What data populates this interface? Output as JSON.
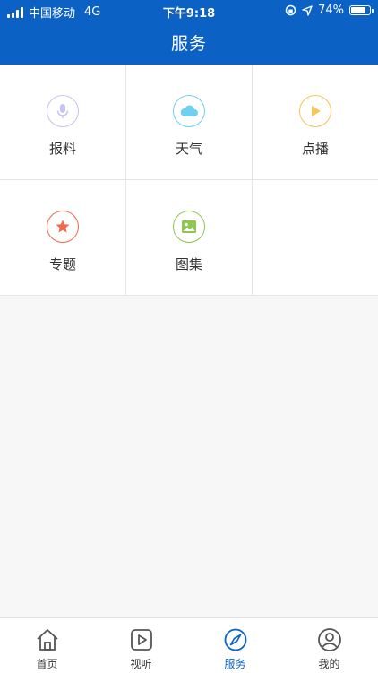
{
  "status_bar": {
    "carrier": "中国移动",
    "network": "4G",
    "time": "下午9:18",
    "battery_percent": "74%",
    "battery_level": 0.74
  },
  "header": {
    "title": "服务"
  },
  "services": [
    {
      "label": "报料",
      "icon": "microphone-icon",
      "color": "#c7c4ef"
    },
    {
      "label": "天气",
      "icon": "cloud-icon",
      "color": "#6fd1ee"
    },
    {
      "label": "点播",
      "icon": "play-icon",
      "color": "#f7c659"
    },
    {
      "label": "专题",
      "icon": "star-icon",
      "color": "#f06a4c"
    },
    {
      "label": "图集",
      "icon": "image-icon",
      "color": "#8ec74d"
    }
  ],
  "tabs": [
    {
      "label": "首页",
      "icon": "home-icon",
      "active": false
    },
    {
      "label": "视听",
      "icon": "video-play-icon",
      "active": false
    },
    {
      "label": "服务",
      "icon": "compass-icon",
      "active": true
    },
    {
      "label": "我的",
      "icon": "user-icon",
      "active": false
    }
  ],
  "colors": {
    "brand": "#0b61c4",
    "text": "#333333",
    "background": "#f7f7f7"
  }
}
